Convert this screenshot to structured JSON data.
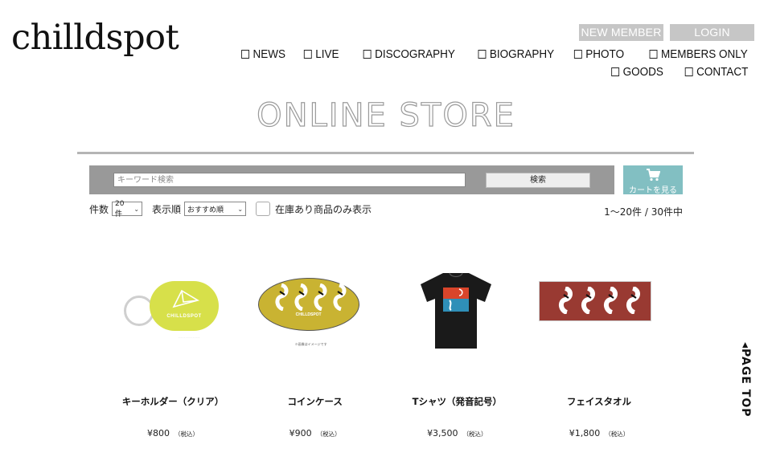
{
  "header": {
    "logo": "chilldspot",
    "auth": {
      "new_member": "NEW MEMBER",
      "login": "LOGIN"
    },
    "nav": [
      {
        "label": "NEWS",
        "icon": "checkbox-icon"
      },
      {
        "label": "LIVE",
        "icon": "checkbox-icon"
      },
      {
        "label": "DISCOGRAPHY",
        "icon": "checkbox-icon"
      },
      {
        "label": "BIOGRAPHY",
        "icon": "checkbox-icon"
      },
      {
        "label": "PHOTO",
        "icon": "checkbox-icon"
      },
      {
        "label": "MEMBERS ONLY",
        "icon": "checkbox-icon"
      },
      {
        "label": "GOODS",
        "icon": "checkbox-icon"
      },
      {
        "label": "CONTACT",
        "icon": "checkbox-icon"
      }
    ]
  },
  "store": {
    "title": "ONLINE STORE",
    "search": {
      "placeholder": "キーワード検索",
      "value": "",
      "button": "検索"
    },
    "cart": {
      "label": "カートを見る",
      "icon": "cart-icon",
      "color": "#82bfc2"
    },
    "filters": {
      "count_label": "件数",
      "count_value": "20件",
      "sort_label": "表示順",
      "sort_value": "おすすめ順",
      "stock_only_label": "在庫あり商品のみ表示",
      "stock_only_checked": false
    },
    "result_count": "1〜20件 / 30件中",
    "products": [
      {
        "name": "キーホルダー（クリア）",
        "price": "¥800",
        "tax": "（税込）",
        "image_logo": "CHILLDSPOT",
        "image_color": "#d7e04a"
      },
      {
        "name": "コインケース",
        "price": "¥900",
        "tax": "（税込）",
        "image_logo": "CHILLDSPOT",
        "image_note": "※画像はイメージです",
        "image_color": "#c9b332"
      },
      {
        "name": "Tシャツ（発音記号）",
        "price": "¥3,500",
        "tax": "（税込）",
        "image_color": "#1a1a1a"
      },
      {
        "name": "フェイスタオル",
        "price": "¥1,800",
        "tax": "（税込）",
        "image_color": "#993a32"
      }
    ]
  },
  "page_top": {
    "label": "◂PAGE TOP"
  }
}
